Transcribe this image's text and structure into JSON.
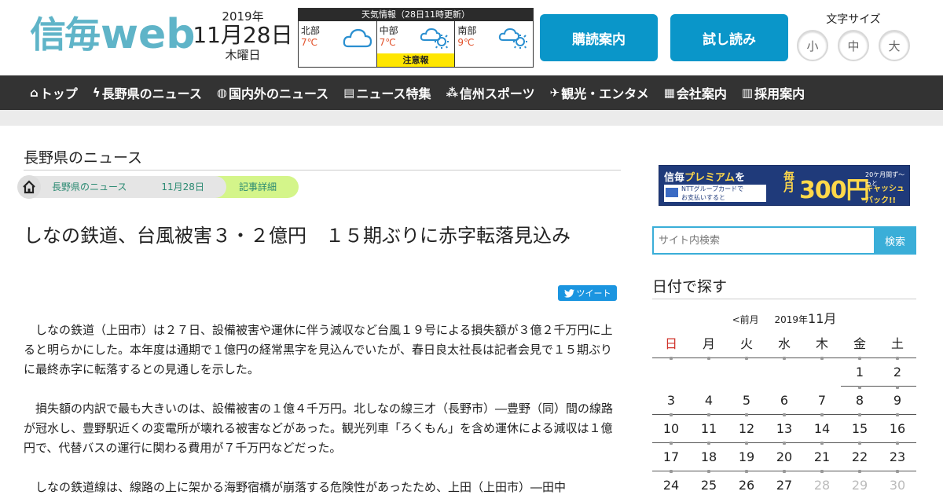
{
  "header": {
    "logo_kanji": "信毎",
    "logo_web": "web",
    "date_year": "2019年",
    "date_md": "11月28日",
    "date_wd": "木曜日",
    "weather": {
      "title": "天気情報（28日11時更新）",
      "regions": [
        {
          "name": "北部",
          "temp": "7℃",
          "icon": "cloud-icon"
        },
        {
          "name": "中部",
          "temp": "7℃",
          "icon": "cloud-sun-icon",
          "warning": "注意報"
        },
        {
          "name": "南部",
          "temp": "9℃",
          "icon": "cloud-sun-icon"
        }
      ]
    },
    "subscribe_label": "購読案内",
    "trial_label": "試し読み",
    "fontsize_label": "文字サイズ",
    "fontsize_options": [
      "小",
      "中",
      "大"
    ]
  },
  "nav": [
    {
      "icon": "home-icon",
      "glyph": "⌂",
      "label": "トップ"
    },
    {
      "icon": "lightning-icon",
      "glyph": "ϟ",
      "label": "長野県のニュース"
    },
    {
      "icon": "globe-icon",
      "glyph": "◍",
      "label": "国内外のニュース"
    },
    {
      "icon": "document-icon",
      "glyph": "▤",
      "label": "ニュース特集"
    },
    {
      "icon": "balls-icon",
      "glyph": "⁂",
      "label": "信州スポーツ"
    },
    {
      "icon": "camera-icon",
      "glyph": "✈",
      "label": "観光・エンタメ"
    },
    {
      "icon": "building-icon",
      "glyph": "▦",
      "label": "会社案内"
    },
    {
      "icon": "list-icon",
      "glyph": "▥",
      "label": "採用案内"
    }
  ],
  "main": {
    "section_title": "長野県のニュース",
    "breadcrumbs": [
      "長野県のニュース",
      "11月28日",
      "記事詳細"
    ],
    "headline": "しなの鉄道、台風被害３・２億円　１５期ぶりに赤字転落見込み",
    "tweet_label": "ツイート",
    "paragraphs": [
      "しなの鉄道（上田市）は２７日、設備被害や運休に伴う減収など台風１９号による損失額が３億２千万円に上ると明らかにした。本年度は通期で１億円の経常黒字を見込んでいたが、春日良太社長は記者会見で１５期ぶりに最終赤字に転落するとの見通しを示した。",
      "損失額の内訳で最も大きいのは、設備被害の１億４千万円。北しなの線三才（長野市）―豊野（同）間の線路が冠水し、豊野駅近くの変電所が壊れる被害などがあった。観光列車「ろくもん」を含め運休による減収は１億円で、代替バスの運行に関わる費用が７千万円などだった。",
      "しなの鉄道線は、線路の上に架かる海野宿橋が崩落する危険性があったため、上田（上田市）―田中"
    ]
  },
  "sidebar": {
    "banner": {
      "brand": "信毎",
      "brand_accent": "プレミアム",
      "brand_suffix": "を",
      "sub_line1": "NTTグループカードで",
      "sub_line2": "お支払いすると",
      "monthly": "毎月",
      "price": "300円",
      "note": "20ケ月間ず〜っと",
      "cashback": "キャッシュバック!!"
    },
    "search_placeholder": "サイト内検索",
    "search_button": "検索",
    "calendar_title": "日付で探す",
    "calendar_prev": "<前月",
    "calendar_year": "2019年",
    "calendar_month": "11月",
    "weekdays": [
      "日",
      "月",
      "火",
      "水",
      "木",
      "金",
      "土"
    ],
    "weeks": [
      [
        "",
        "",
        "",
        "",
        "",
        "1",
        "2"
      ],
      [
        "3",
        "4",
        "5",
        "6",
        "7",
        "8",
        "9"
      ],
      [
        "10",
        "11",
        "12",
        "13",
        "14",
        "15",
        "16"
      ],
      [
        "17",
        "18",
        "19",
        "20",
        "21",
        "22",
        "23"
      ],
      [
        "24",
        "25",
        "26",
        "27",
        "28",
        "29",
        "30"
      ]
    ],
    "dim_days": [
      "28",
      "29",
      "30"
    ]
  },
  "colors": {
    "brand": "#5fb4c8",
    "button": "#0a96c9",
    "nav_bg": "#333333",
    "search": "#3aaed8",
    "sunday": "#d0342c",
    "warning": "#ffe600"
  }
}
